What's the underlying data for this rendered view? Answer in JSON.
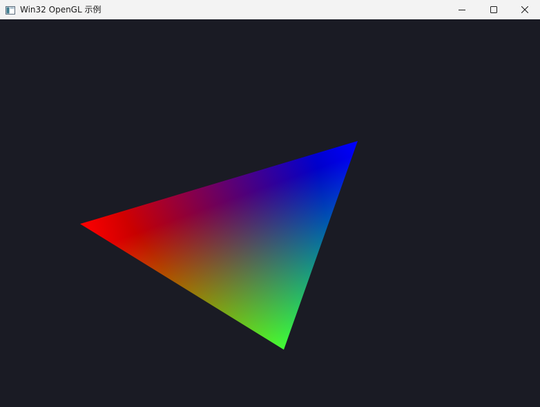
{
  "window": {
    "title": "Win32 OpenGL 示例",
    "icon": "window-app-icon"
  },
  "caption_buttons": {
    "minimize_icon": "minimize-icon",
    "maximize_icon": "maximize-icon",
    "close_icon": "close-icon"
  },
  "scene": {
    "background_color": "#1a1b24",
    "triangle": {
      "vertex_colors": [
        "#ff0000",
        "#0000ff",
        "#00ff00"
      ]
    }
  }
}
